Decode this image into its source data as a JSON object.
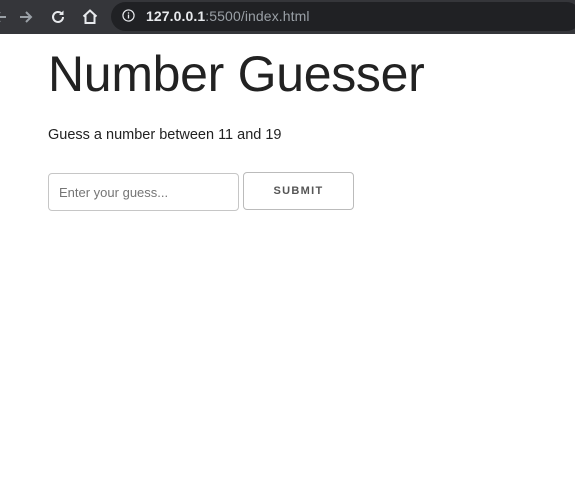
{
  "browser": {
    "url_host": "127.0.0.1",
    "url_rest": ":5500/index.html",
    "icons": {
      "back": "arrow-left-icon",
      "forward": "arrow-right-icon",
      "reload": "reload-icon",
      "home": "home-icon",
      "info": "info-icon"
    },
    "colors": {
      "toolbar": "#35363a",
      "omnibox": "#202124"
    }
  },
  "page": {
    "title": "Number Guesser",
    "instructions": "Guess a number between 11 and 19",
    "guess_input": {
      "value": "",
      "placeholder": "Enter your guess..."
    },
    "submit_label": "Submit"
  }
}
